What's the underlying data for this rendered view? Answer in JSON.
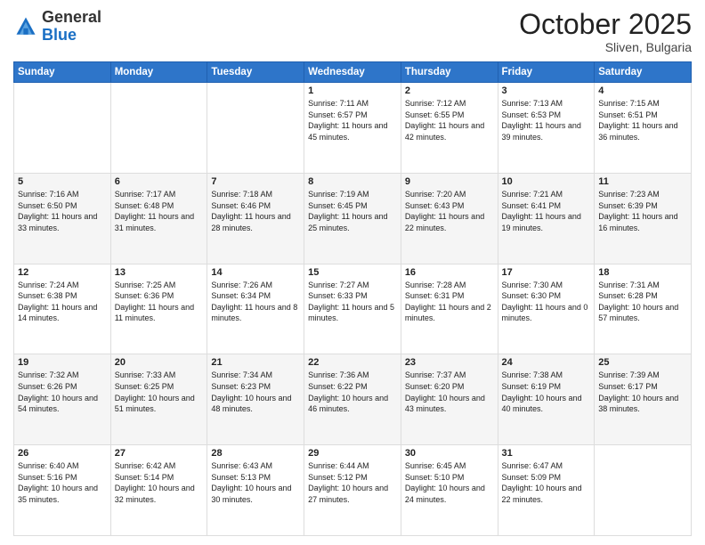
{
  "header": {
    "logo_line1": "General",
    "logo_line2": "Blue",
    "title": "October 2025",
    "subtitle": "Sliven, Bulgaria"
  },
  "days_of_week": [
    "Sunday",
    "Monday",
    "Tuesday",
    "Wednesday",
    "Thursday",
    "Friday",
    "Saturday"
  ],
  "weeks": [
    [
      {
        "day": "",
        "info": ""
      },
      {
        "day": "",
        "info": ""
      },
      {
        "day": "",
        "info": ""
      },
      {
        "day": "1",
        "info": "Sunrise: 7:11 AM\nSunset: 6:57 PM\nDaylight: 11 hours and 45 minutes."
      },
      {
        "day": "2",
        "info": "Sunrise: 7:12 AM\nSunset: 6:55 PM\nDaylight: 11 hours and 42 minutes."
      },
      {
        "day": "3",
        "info": "Sunrise: 7:13 AM\nSunset: 6:53 PM\nDaylight: 11 hours and 39 minutes."
      },
      {
        "day": "4",
        "info": "Sunrise: 7:15 AM\nSunset: 6:51 PM\nDaylight: 11 hours and 36 minutes."
      }
    ],
    [
      {
        "day": "5",
        "info": "Sunrise: 7:16 AM\nSunset: 6:50 PM\nDaylight: 11 hours and 33 minutes."
      },
      {
        "day": "6",
        "info": "Sunrise: 7:17 AM\nSunset: 6:48 PM\nDaylight: 11 hours and 31 minutes."
      },
      {
        "day": "7",
        "info": "Sunrise: 7:18 AM\nSunset: 6:46 PM\nDaylight: 11 hours and 28 minutes."
      },
      {
        "day": "8",
        "info": "Sunrise: 7:19 AM\nSunset: 6:45 PM\nDaylight: 11 hours and 25 minutes."
      },
      {
        "day": "9",
        "info": "Sunrise: 7:20 AM\nSunset: 6:43 PM\nDaylight: 11 hours and 22 minutes."
      },
      {
        "day": "10",
        "info": "Sunrise: 7:21 AM\nSunset: 6:41 PM\nDaylight: 11 hours and 19 minutes."
      },
      {
        "day": "11",
        "info": "Sunrise: 7:23 AM\nSunset: 6:39 PM\nDaylight: 11 hours and 16 minutes."
      }
    ],
    [
      {
        "day": "12",
        "info": "Sunrise: 7:24 AM\nSunset: 6:38 PM\nDaylight: 11 hours and 14 minutes."
      },
      {
        "day": "13",
        "info": "Sunrise: 7:25 AM\nSunset: 6:36 PM\nDaylight: 11 hours and 11 minutes."
      },
      {
        "day": "14",
        "info": "Sunrise: 7:26 AM\nSunset: 6:34 PM\nDaylight: 11 hours and 8 minutes."
      },
      {
        "day": "15",
        "info": "Sunrise: 7:27 AM\nSunset: 6:33 PM\nDaylight: 11 hours and 5 minutes."
      },
      {
        "day": "16",
        "info": "Sunrise: 7:28 AM\nSunset: 6:31 PM\nDaylight: 11 hours and 2 minutes."
      },
      {
        "day": "17",
        "info": "Sunrise: 7:30 AM\nSunset: 6:30 PM\nDaylight: 11 hours and 0 minutes."
      },
      {
        "day": "18",
        "info": "Sunrise: 7:31 AM\nSunset: 6:28 PM\nDaylight: 10 hours and 57 minutes."
      }
    ],
    [
      {
        "day": "19",
        "info": "Sunrise: 7:32 AM\nSunset: 6:26 PM\nDaylight: 10 hours and 54 minutes."
      },
      {
        "day": "20",
        "info": "Sunrise: 7:33 AM\nSunset: 6:25 PM\nDaylight: 10 hours and 51 minutes."
      },
      {
        "day": "21",
        "info": "Sunrise: 7:34 AM\nSunset: 6:23 PM\nDaylight: 10 hours and 48 minutes."
      },
      {
        "day": "22",
        "info": "Sunrise: 7:36 AM\nSunset: 6:22 PM\nDaylight: 10 hours and 46 minutes."
      },
      {
        "day": "23",
        "info": "Sunrise: 7:37 AM\nSunset: 6:20 PM\nDaylight: 10 hours and 43 minutes."
      },
      {
        "day": "24",
        "info": "Sunrise: 7:38 AM\nSunset: 6:19 PM\nDaylight: 10 hours and 40 minutes."
      },
      {
        "day": "25",
        "info": "Sunrise: 7:39 AM\nSunset: 6:17 PM\nDaylight: 10 hours and 38 minutes."
      }
    ],
    [
      {
        "day": "26",
        "info": "Sunrise: 6:40 AM\nSunset: 5:16 PM\nDaylight: 10 hours and 35 minutes."
      },
      {
        "day": "27",
        "info": "Sunrise: 6:42 AM\nSunset: 5:14 PM\nDaylight: 10 hours and 32 minutes."
      },
      {
        "day": "28",
        "info": "Sunrise: 6:43 AM\nSunset: 5:13 PM\nDaylight: 10 hours and 30 minutes."
      },
      {
        "day": "29",
        "info": "Sunrise: 6:44 AM\nSunset: 5:12 PM\nDaylight: 10 hours and 27 minutes."
      },
      {
        "day": "30",
        "info": "Sunrise: 6:45 AM\nSunset: 5:10 PM\nDaylight: 10 hours and 24 minutes."
      },
      {
        "day": "31",
        "info": "Sunrise: 6:47 AM\nSunset: 5:09 PM\nDaylight: 10 hours and 22 minutes."
      },
      {
        "day": "",
        "info": ""
      }
    ]
  ]
}
